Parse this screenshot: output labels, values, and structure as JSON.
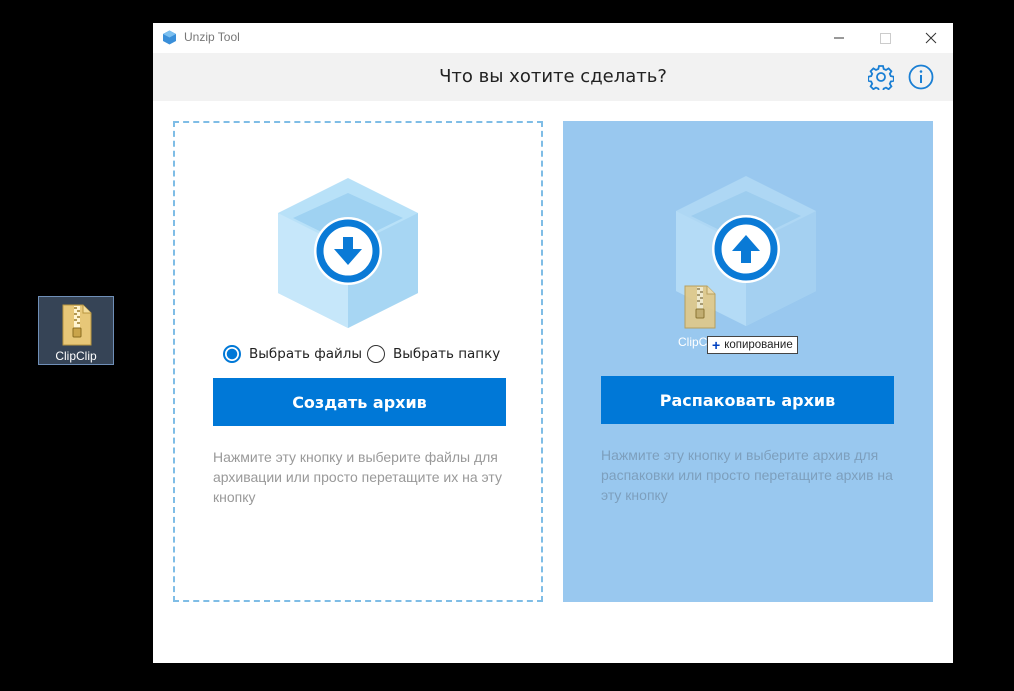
{
  "desktop": {
    "icon_label": "ClipClip",
    "icon": "zip-folder-icon"
  },
  "window": {
    "title": "Unzip Tool",
    "controls": {
      "minimize": "minimize-icon",
      "maximize": "maximize-icon",
      "close": "close-icon"
    }
  },
  "header": {
    "title": "Что вы хотите сделать?",
    "settings_icon": "gear-icon",
    "info_icon": "info-icon"
  },
  "create_panel": {
    "radio_files": "Выбрать файлы",
    "radio_folder": "Выбрать папку",
    "selected_option": "Выбрать файлы",
    "button": "Создать архив",
    "hint": "Нажмите эту кнопку и выберите файлы для архивации или просто перетащите их на эту кнопку"
  },
  "extract_panel": {
    "button": "Распаковать архив",
    "hint": "Нажмите эту кнопку и выберите архив для распаковки или просто перетащите архив на эту кнопку"
  },
  "drag": {
    "file_label": "ClipC",
    "tooltip": "копирование",
    "tooltip_icon": "plus-icon"
  },
  "colors": {
    "accent": "#0078d7",
    "panel_highlight": "#99c8ef",
    "cube": "#a9dcf6",
    "dashed_border": "#7fbde6"
  }
}
